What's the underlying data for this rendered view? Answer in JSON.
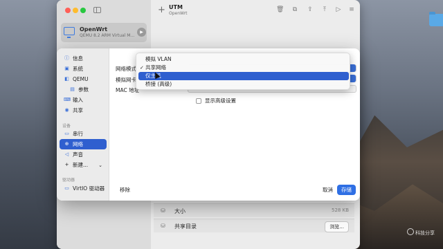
{
  "desktop": {
    "folder_label": ""
  },
  "utm": {
    "title": "UTM",
    "subtitle": "OpenWrt",
    "vm": {
      "name": "OpenWrt",
      "description": "QEMU 8.2 ARM Virtual M..."
    },
    "details": [
      {
        "label": "大小",
        "value": "528 KB",
        "icon": "drive-icon"
      },
      {
        "label": "共享目录",
        "button": "浏览...",
        "icon": "folder-share-icon"
      }
    ]
  },
  "settings": {
    "sidebar": {
      "items": [
        {
          "label": "信息",
          "icon": "info-icon"
        },
        {
          "label": "系统",
          "icon": "cpu-icon"
        },
        {
          "label": "QEMU",
          "icon": "qemu-icon"
        },
        {
          "label": "参数",
          "icon": "args-icon"
        },
        {
          "label": "输入",
          "icon": "keyboard-icon"
        },
        {
          "label": "共享",
          "icon": "user-icon"
        }
      ],
      "section_devices": "设备",
      "device_items": [
        {
          "label": "串行",
          "icon": "serial-icon"
        },
        {
          "label": "网络",
          "icon": "globe-icon",
          "selected": true
        },
        {
          "label": "声音",
          "icon": "speaker-icon"
        },
        {
          "label": "新建...",
          "icon": "plus-icon"
        }
      ],
      "section_drives": "驱动器",
      "drive_items": [
        {
          "label": "VirtIO 驱动器",
          "icon": "disk-icon"
        }
      ]
    },
    "form": {
      "network_mode_label": "网络模式",
      "emulated_card_label": "模拟网卡",
      "mac_label": "MAC 地址",
      "mac_value": "",
      "show_advanced_label": "显示高级设置"
    },
    "footer": {
      "remove": "移除",
      "cancel": "取消",
      "save": "存储"
    },
    "dropdown": {
      "options": [
        "模拟 VLAN",
        "共享网络",
        "仅主机",
        "桥接 (高级)"
      ],
      "checked": "共享网络",
      "highlighted": "仅主机",
      "check_glyph": "✓"
    }
  },
  "watermark": "科技分享",
  "colors": {
    "accent": "#2f5fcf",
    "save_button": "#2f6fe4"
  }
}
